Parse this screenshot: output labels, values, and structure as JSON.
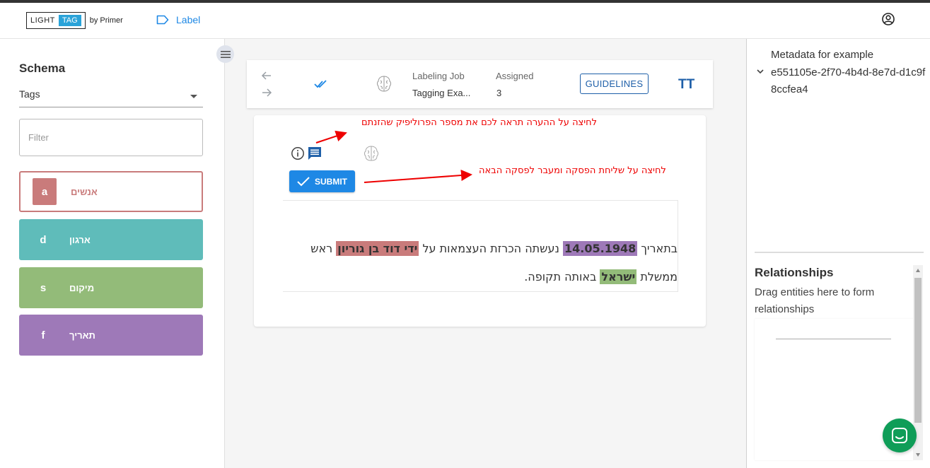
{
  "header": {
    "logo_light": "LIGHT",
    "logo_tag": "TAG",
    "logo_by": "by Primer",
    "nav_label": "Label",
    "icons": {
      "label": "label-tag-icon",
      "account": "account-circle-icon"
    }
  },
  "sidebar": {
    "title": "Schema",
    "select_value": "Tags",
    "filter_placeholder": "Filter",
    "tags": [
      {
        "key": "a",
        "label": "אנשים",
        "color": "#c97b7b"
      },
      {
        "key": "d",
        "label": "ארגון",
        "color": "#5fbcba"
      },
      {
        "key": "s",
        "label": "מיקום",
        "color": "#93bb79"
      },
      {
        "key": "f",
        "label": "תאריך",
        "color": "#9e79b8"
      }
    ]
  },
  "toolbar": {
    "job_label": "Labeling Job",
    "job_value": "Tagging Exa...",
    "assigned_label": "Assigned",
    "assigned_value": "3",
    "guidelines_label": "GUIDELINES",
    "font_icon": "TT",
    "accent": "#1e5fa8"
  },
  "example": {
    "submit_label": "SUBMIT",
    "line1_pre": "בתאריך ",
    "span_date": "14.05.1948",
    "line1_mid": " נעשתה הכרזת העצמאות על ",
    "span_person": "ידי דוד בן גוריון",
    "line1_post": " ראש",
    "line2_pre": "ממשלת ",
    "span_place": "ישראל",
    "line2_post": " באותה תקופה."
  },
  "annotations": {
    "comment_hint": "לחיצה על ההערה תראה לכם את מספר הפרוליפיק שהזנתם",
    "submit_hint": "לחיצה על שליחת הפסקה ומעבר לפסקה הבאה",
    "color": "#e00000"
  },
  "right_panel": {
    "metadata_title": "Metadata for example",
    "metadata_id": "e551105e-2f70-4b4d-8e7d-d1c9f8ccfea4",
    "relationships_title": "Relationships",
    "relationships_hint": "Drag entities here to form relationships"
  }
}
